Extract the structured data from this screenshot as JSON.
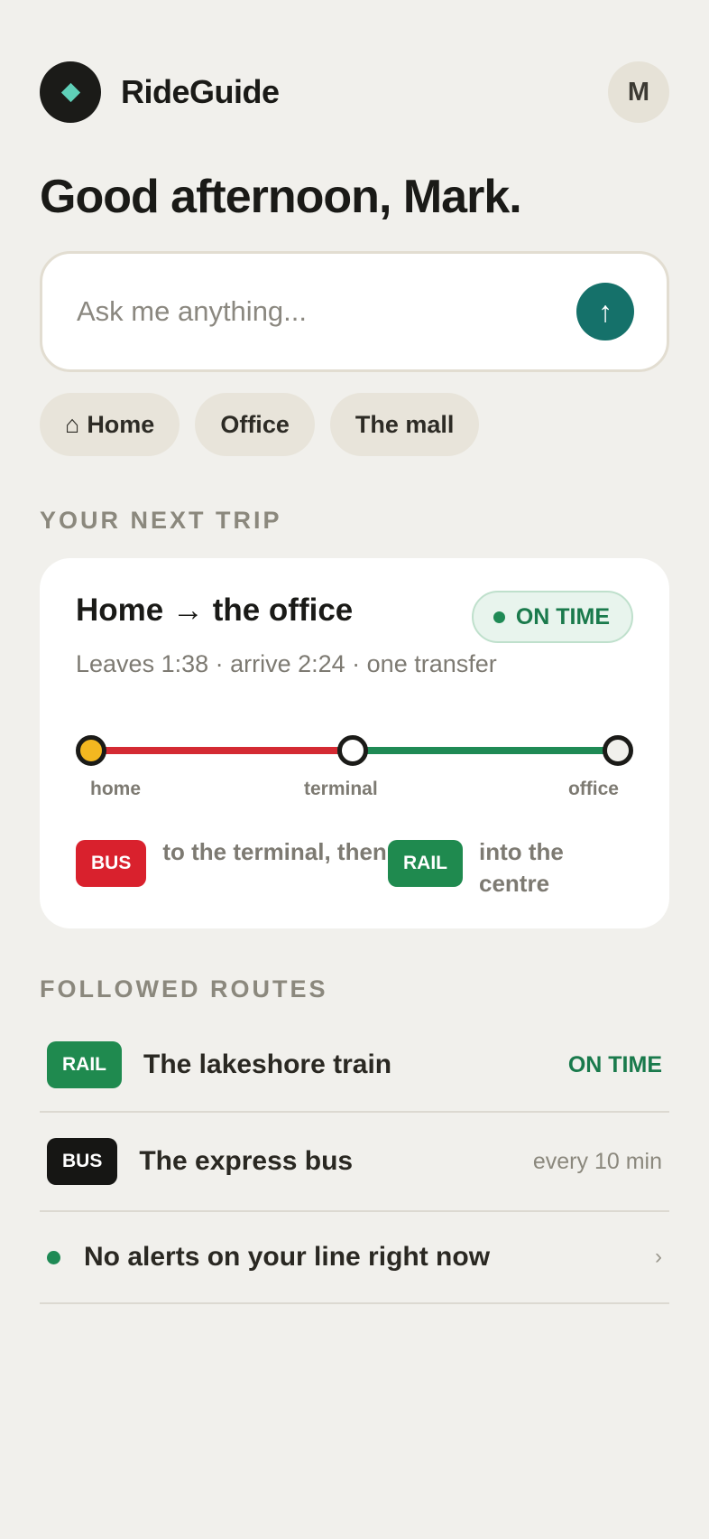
{
  "header": {
    "app_name": "RideGuide",
    "avatar_initial": "M",
    "logo_icon": "diamond-icon"
  },
  "greeting": "Good afternoon, Mark.",
  "search": {
    "placeholder": "Ask me anything...",
    "value": "",
    "send_icon": "arrow-up-icon",
    "send_glyph": "↑"
  },
  "quick_places": [
    {
      "icon_glyph": "⌂",
      "icon": "home-icon",
      "label": "Home"
    },
    {
      "label": "Office"
    },
    {
      "label": "The mall"
    }
  ],
  "next_trip": {
    "section_label": "YOUR NEXT TRIP",
    "title": "Home → the office",
    "status": "ON TIME",
    "subtitle": "Leaves 1:38 · arrive 2:24 · one transfer",
    "stops": [
      "home",
      "terminal",
      "office"
    ],
    "legs": [
      {
        "mode": "BUS",
        "text": "to the terminal, then",
        "color": "#d9212d"
      },
      {
        "mode": "RAIL",
        "text": "into the centre",
        "color": "#1f8a4f"
      }
    ]
  },
  "followed": {
    "section_label": "FOLLOWED ROUTES",
    "routes": [
      {
        "mode": "RAIL",
        "name": "The lakeshore train",
        "status": "ON TIME"
      },
      {
        "mode": "BUS",
        "name": "The express bus",
        "status": "every 10 min"
      }
    ],
    "alert": {
      "text": "No alerts on your line right now",
      "chevron": "›"
    }
  },
  "colors": {
    "accent": "#15716a",
    "on_time_green": "#1a7a4c",
    "bus_red": "#d9212d",
    "rail_green": "#1f8a4f",
    "home_stop_yellow": "#f4b820"
  }
}
